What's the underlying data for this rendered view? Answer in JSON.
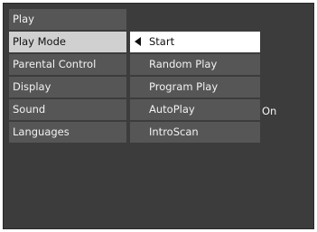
{
  "menu": {
    "items": [
      {
        "label": "Play"
      },
      {
        "label": "Play Mode"
      },
      {
        "label": "Parental Control"
      },
      {
        "label": "Display"
      },
      {
        "label": "Sound"
      },
      {
        "label": "Languages"
      }
    ],
    "selected": "Play Mode"
  },
  "submenu": {
    "items": [
      {
        "label": "Start"
      },
      {
        "label": "Random Play"
      },
      {
        "label": "Program Play"
      },
      {
        "label": "AutoPlay",
        "value": "On"
      },
      {
        "label": "IntroScan"
      }
    ],
    "selected": "Start"
  },
  "colors": {
    "screen_background": "#3c3c3c",
    "item_background": "#565656",
    "selected_menu_background": "#d0d0d0",
    "selected_submenu_background": "#ffffff",
    "text": "#f2f2f2"
  },
  "icons": {
    "selection_indicator": "left-arrow-icon"
  }
}
